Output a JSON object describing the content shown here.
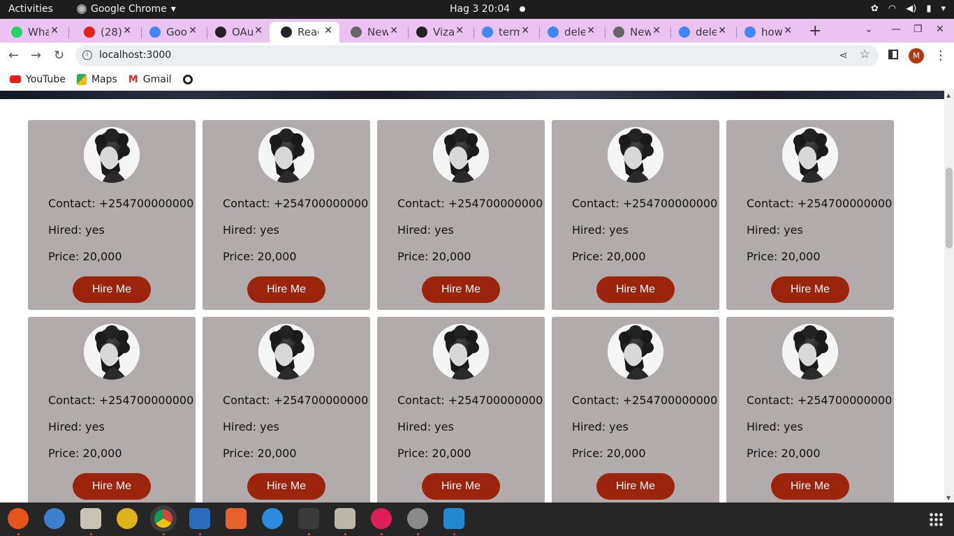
{
  "topbar": {
    "activities": "Activities",
    "app_name": "Google Chrome",
    "clock": "Hag 3  20:04"
  },
  "tabs": [
    {
      "label": "Wha",
      "icon": "whatsapp-icon",
      "color": "#25d366"
    },
    {
      "label": "(28)",
      "icon": "youtube-icon",
      "color": "#e62117"
    },
    {
      "label": "Goo",
      "icon": "google-drive-icon",
      "color": "#4285f4"
    },
    {
      "label": "OAu",
      "icon": "github-icon",
      "color": "#222222"
    },
    {
      "label": "Reac",
      "icon": "react-icon",
      "color": "#20232a",
      "active": true
    },
    {
      "label": "New",
      "icon": "chrome-icon",
      "color": "#666666"
    },
    {
      "label": "Viza",
      "icon": "github-icon",
      "color": "#222222"
    },
    {
      "label": "term",
      "icon": "google-icon",
      "color": "#4285f4"
    },
    {
      "label": "dele",
      "icon": "google-icon",
      "color": "#4285f4"
    },
    {
      "label": "New",
      "icon": "chrome-icon",
      "color": "#666666"
    },
    {
      "label": "dele",
      "icon": "google-icon",
      "color": "#4285f4"
    },
    {
      "label": "how",
      "icon": "google-icon",
      "color": "#4285f4"
    }
  ],
  "toolbar": {
    "url": "localhost:3000",
    "profile_initial": "M"
  },
  "bookmarks": [
    {
      "label": "YouTube",
      "icon": "youtube-icon"
    },
    {
      "label": "Maps",
      "icon": "maps-icon"
    },
    {
      "label": "Gmail",
      "icon": "gmail-icon"
    }
  ],
  "cards": [
    {
      "contact": "Contact: +254700000000",
      "hired": "Hired: yes",
      "price": "Price: 20,000",
      "button": "Hire Me"
    },
    {
      "contact": "Contact: +254700000000",
      "hired": "Hired: yes",
      "price": "Price: 20,000",
      "button": "Hire Me"
    },
    {
      "contact": "Contact: +254700000000",
      "hired": "Hired: yes",
      "price": "Price: 20,000",
      "button": "Hire Me"
    },
    {
      "contact": "Contact: +254700000000",
      "hired": "Hired: yes",
      "price": "Price: 20,000",
      "button": "Hire Me"
    },
    {
      "contact": "Contact: +254700000000",
      "hired": "Hired: yes",
      "price": "Price: 20,000",
      "button": "Hire Me"
    },
    {
      "contact": "Contact: +254700000000",
      "hired": "Hired: yes",
      "price": "Price: 20,000",
      "button": "Hire Me"
    },
    {
      "contact": "Contact: +254700000000",
      "hired": "Hired: yes",
      "price": "Price: 20,000",
      "button": "Hire Me"
    },
    {
      "contact": "Contact: +254700000000",
      "hired": "Hired: yes",
      "price": "Price: 20,000",
      "button": "Hire Me"
    },
    {
      "contact": "Contact: +254700000000",
      "hired": "Hired: yes",
      "price": "Price: 20,000",
      "button": "Hire Me"
    },
    {
      "contact": "Contact: +254700000000",
      "hired": "Hired: yes",
      "price": "Price: 20,000",
      "button": "Hire Me"
    }
  ],
  "colors": {
    "tabstrip": "#ebc3f1",
    "card_bg": "#b1acab",
    "hire_button": "#9c230c"
  },
  "dock": [
    {
      "name": "firefox-icon",
      "color": "#e9541c",
      "running": true
    },
    {
      "name": "thunderbird-icon",
      "color": "#3d7fd1",
      "running": false
    },
    {
      "name": "files-icon",
      "color": "#c9c3b6",
      "running": true
    },
    {
      "name": "rhythmbox-icon",
      "color": "#e0b21a",
      "running": false
    },
    {
      "name": "chrome-icon",
      "color": "#3a8f3f",
      "running": true
    },
    {
      "name": "text-editor-icon",
      "color": "#2b6cbf",
      "running": true
    },
    {
      "name": "software-icon",
      "color": "#e8602c",
      "running": false
    },
    {
      "name": "help-icon",
      "color": "#2a8ce0",
      "running": false
    },
    {
      "name": "terminal-icon",
      "color": "#3b3b3b",
      "running": true
    },
    {
      "name": "archive-icon",
      "color": "#bdb7a9",
      "running": true
    },
    {
      "name": "slack-icon",
      "color": "#e01e5a",
      "running": true
    },
    {
      "name": "settings-icon",
      "color": "#8a8a8a",
      "running": true
    },
    {
      "name": "vscode-icon",
      "color": "#1f8ad2",
      "running": true
    }
  ]
}
